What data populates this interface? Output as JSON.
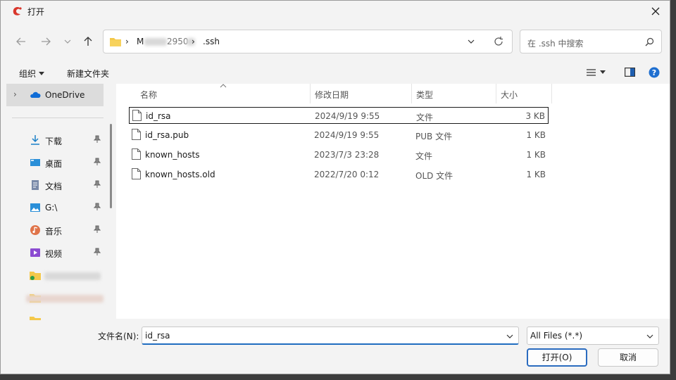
{
  "window": {
    "title": "打开",
    "close_icon": "close-icon"
  },
  "nav": {
    "back_icon": "arrow-left-icon",
    "forward_icon": "arrow-right-icon",
    "recent_icon": "chevron-down-icon",
    "up_icon": "arrow-up-icon",
    "path_segment_start": "M",
    "path_segment_partial": "2950",
    "path_last": ".ssh",
    "search_placeholder": "在 .ssh 中搜索"
  },
  "commands": {
    "organize": "组织",
    "new_folder": "新建文件夹"
  },
  "sidebar": {
    "items": [
      {
        "label": "OneDrive",
        "icon": "cloud-icon"
      },
      {
        "label": "下载",
        "icon": "download-icon",
        "pinned": true
      },
      {
        "label": "桌面",
        "icon": "desktop-icon",
        "pinned": true
      },
      {
        "label": "文档",
        "icon": "document-icon",
        "pinned": true
      },
      {
        "label": "G:\\",
        "icon": "image-icon",
        "pinned": true
      },
      {
        "label": "音乐",
        "icon": "music-icon",
        "pinned": true
      },
      {
        "label": "视频",
        "icon": "video-icon",
        "pinned": true
      }
    ]
  },
  "columns": {
    "name": "名称",
    "modified": "修改日期",
    "type": "类型",
    "size": "大小"
  },
  "files": [
    {
      "name": "id_rsa",
      "modified": "2024/9/19 9:55",
      "type": "文件",
      "size": "3 KB",
      "selected": true
    },
    {
      "name": "id_rsa.pub",
      "modified": "2024/9/19 9:55",
      "type": "PUB 文件",
      "size": "1 KB"
    },
    {
      "name": "known_hosts",
      "modified": "2023/7/3 23:28",
      "type": "文件",
      "size": "1 KB"
    },
    {
      "name": "known_hosts.old",
      "modified": "2022/7/20 0:12",
      "type": "OLD 文件",
      "size": "1 KB"
    }
  ],
  "bottom": {
    "filename_label": "文件名(N):",
    "filename_value": "id_rsa",
    "filetype_value": "All Files (*.*)",
    "open_label": "打开(O)",
    "cancel_label": "取消"
  }
}
